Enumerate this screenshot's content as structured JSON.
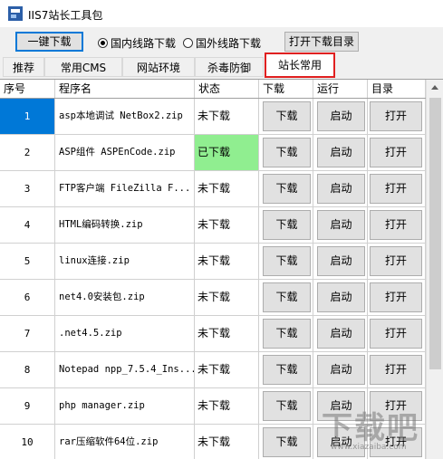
{
  "window": {
    "title": "IIS7站长工具包"
  },
  "toolbar": {
    "one_key_download": "一键下载",
    "radio_domestic": "国内线路下载",
    "radio_foreign": "国外线路下载",
    "open_download_dir": "打开下载目录",
    "selected_route": "domestic"
  },
  "tabs": [
    {
      "label": "推荐"
    },
    {
      "label": "常用CMS"
    },
    {
      "label": "网站环境"
    },
    {
      "label": "杀毒防御"
    },
    {
      "label": "站长常用",
      "active": true
    }
  ],
  "table": {
    "headers": [
      "序号",
      "程序名",
      "状态",
      "下载",
      "运行",
      "目录"
    ],
    "button_labels": {
      "download": "下载",
      "run": "启动",
      "open": "打开"
    },
    "rows": [
      {
        "no": "1",
        "name": "asp本地调试 NetBox2.zip",
        "status": "未下载",
        "selected": true
      },
      {
        "no": "2",
        "name": "ASP组件 ASPEnCode.zip",
        "status": "已下载",
        "downloaded": true
      },
      {
        "no": "3",
        "name": "FTP客户端 FileZilla F...",
        "status": "未下载"
      },
      {
        "no": "4",
        "name": "HTML编码转换.zip",
        "status": "未下载"
      },
      {
        "no": "5",
        "name": "linux连接.zip",
        "status": "未下载"
      },
      {
        "no": "6",
        "name": "net4.0安装包.zip",
        "status": "未下载"
      },
      {
        "no": "7",
        "name": ".net4.5.zip",
        "status": "未下载"
      },
      {
        "no": "8",
        "name": "Notepad npp_7.5.4_Ins...",
        "status": "未下载"
      },
      {
        "no": "9",
        "name": "php manager.zip",
        "status": "未下载"
      },
      {
        "no": "10",
        "name": "rar压缩软件64位.zip",
        "status": "未下载"
      }
    ]
  },
  "colors": {
    "selection": "#0078d7",
    "downloaded": "#90ee90",
    "active_tab_border": "#e02020"
  },
  "watermark": {
    "text": "下载吧",
    "url": "www.xiazaiba.com"
  }
}
